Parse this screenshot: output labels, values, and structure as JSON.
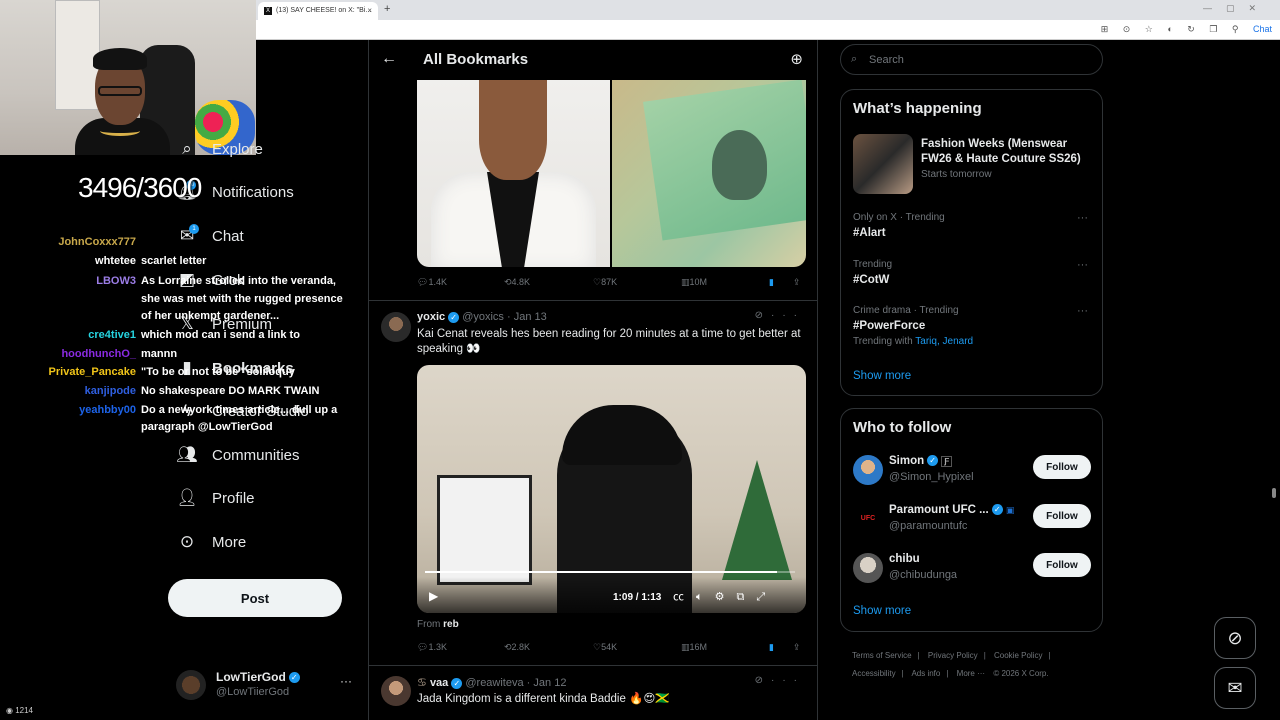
{
  "browser": {
    "tab_title": "(13) SAY CHEESE! on X: \"Bi...",
    "tab_icon": "X",
    "new_tab": "+",
    "profile_label": "Chat"
  },
  "overlay": {
    "counter": "3496/3600",
    "viewers": "1214",
    "chat": [
      {
        "user": "JohnCoxxx777",
        "color": "#c8a84b",
        "text": ""
      },
      {
        "user": "whtetee",
        "color": "#ffffff",
        "text": "scarlet letter"
      },
      {
        "user": "LBOW3",
        "color": "#9b7de6",
        "text": "As Lorraine strolled into the veranda,"
      },
      {
        "user": "",
        "color": "#ffffff",
        "text": "she was met with the rugged presence"
      },
      {
        "user": "",
        "color": "#ffffff",
        "text": "of her unkempt gardener..."
      },
      {
        "user": "cre4tive1",
        "color": "#26d4e0",
        "text": "which mod can i send a link to"
      },
      {
        "user": "hoodhunchO_",
        "color": "#8a2be2",
        "text": "mannn"
      },
      {
        "user": "Private_Pancake",
        "color": "#f0c419",
        "text": "\"To be or not to be\" soliloquy"
      },
      {
        "user": "kanjipode",
        "color": "#2f5fe0",
        "text": "No shakespeare DO MARK TWAIN"
      },
      {
        "user": "yeahbby00",
        "color": "#1d63e8",
        "text": "Do a newyork times article... dull up a"
      },
      {
        "user": "",
        "color": "#ffffff",
        "text": "paragraph @LowTierGod"
      }
    ]
  },
  "nav": {
    "items": [
      {
        "label": "Explore",
        "icon": "search-icon"
      },
      {
        "label": "Notifications",
        "icon": "bell-icon",
        "badge": "10"
      },
      {
        "label": "Chat",
        "icon": "mail-icon",
        "badge": "1"
      },
      {
        "label": "Grok",
        "icon": "grok-icon"
      },
      {
        "label": "Premium",
        "icon": "x-logo-icon"
      },
      {
        "label": "Bookmarks",
        "icon": "bookmark-icon"
      },
      {
        "label": "Creator Studio",
        "icon": "lightning-icon"
      },
      {
        "label": "Communities",
        "icon": "people-icon"
      },
      {
        "label": "Profile",
        "icon": "person-icon"
      },
      {
        "label": "More",
        "icon": "more-circle-icon"
      }
    ],
    "post_label": "Post",
    "account": {
      "name": "LowTierGod",
      "handle": "@LowTiierGod",
      "more": "···"
    }
  },
  "main": {
    "title": "All Bookmarks",
    "tweets": [
      {
        "stats": {
          "replies": "1.4K",
          "reposts": "4.8K",
          "likes": "87K",
          "views": "10M"
        }
      },
      {
        "name": "yoxic",
        "handle": "@yoxics",
        "date": "Jan 13",
        "text": "Kai Cenat reveals hes been reading for 20 minutes at a time to get better at speaking 👀",
        "video": {
          "time": "1:09 / 1:13",
          "progress": 0.95
        },
        "from_label": "From",
        "from_user": "reb",
        "stats": {
          "replies": "1.3K",
          "reposts": "2.8K",
          "likes": "54K",
          "views": "16M"
        }
      },
      {
        "name": "vaa",
        "handle": "@reawiteva",
        "date": "Jan 12",
        "text": "Jada Kingdom is a different kinda Baddie 🔥😍🇯🇲"
      }
    ]
  },
  "sidebar": {
    "search_placeholder": "Search",
    "happening": {
      "title": "What’s happening",
      "event_title": "Fashion Weeks (Menswear FW26 & Haute Couture SS26)",
      "event_meta": "Starts tomorrow",
      "trends": [
        {
          "meta": "Only on X · Trending",
          "title": "#Alart",
          "extra": ""
        },
        {
          "meta": "Trending",
          "title": "#CotW",
          "extra": ""
        },
        {
          "meta": "Crime drama · Trending",
          "title": "#PowerForce",
          "extra_prefix": "Trending with",
          "extra_links": "Tariq, Jenard"
        }
      ],
      "show_more": "Show more"
    },
    "who_to_follow": {
      "title": "Who to follow",
      "users": [
        {
          "name": "Simon",
          "handle": "@Simon_Hypixel"
        },
        {
          "name": "Paramount UFC ...",
          "handle": "@paramountufc"
        },
        {
          "name": "chibu",
          "handle": "@chibudunga"
        }
      ],
      "follow_label": "Follow",
      "show_more": "Show more"
    },
    "footer": [
      "Terms of Service",
      "|",
      "Privacy Policy",
      "|",
      "Cookie Policy",
      "|",
      "Accessibility",
      "|",
      "Ads info",
      "|",
      "More ···",
      "© 2026 X Corp."
    ]
  },
  "colors": {
    "accent": "#1d9bf0",
    "background": "#000000",
    "border": "#2f3336",
    "muted": "#71767b"
  }
}
